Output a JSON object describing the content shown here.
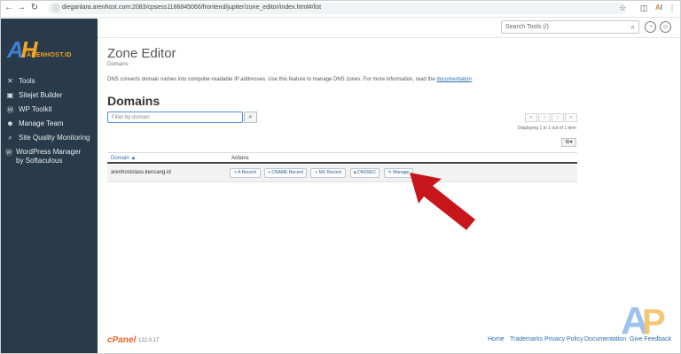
{
  "browser": {
    "url": "dieganlara.arenhost.com:2083/cpsess1186845066/frontend/jupiter/zone_editor/index.html#/list",
    "back_icon": "arrow-left",
    "forward_icon": "arrow-right",
    "reload_icon": "reload",
    "info_icon": "info"
  },
  "sidebar": {
    "logo_mark": "AH",
    "logo_text": "ARENHOST.ID",
    "items": [
      {
        "label": "Tools",
        "icon": "wrench-icon",
        "glyph": "✕"
      },
      {
        "label": "Sitejet Builder",
        "icon": "sitejet-icon",
        "glyph": "▣"
      },
      {
        "label": "WP Toolkit",
        "icon": "wordpress-icon",
        "glyph": "Ⓦ"
      },
      {
        "label": "Manage Team",
        "icon": "team-icon",
        "glyph": "☻"
      },
      {
        "label": "Site Quality Monitoring",
        "icon": "monitor-icon",
        "glyph": "⌕"
      },
      {
        "label": "WordPress Manager by Softaculous",
        "icon": "wordpress-manager-icon",
        "glyph": "Ⓦ"
      }
    ]
  },
  "header": {
    "search_placeholder": "Search Tools (/)"
  },
  "main": {
    "title": "Zone Editor",
    "breadcrumb": "Domains",
    "description": "DNS converts domain names into computer-readable IP addresses. Use this feature to manage DNS zones. For more information, read the",
    "doc_link": "documentation",
    "section_title": "Domains",
    "filter_placeholder": "Filter by domain",
    "pager": [
      "«",
      "‹",
      "›",
      "»"
    ],
    "displaying": "Displaying 1 to 1 out of 1 item",
    "table": {
      "col_domain": "Domain",
      "col_actions": "Actions",
      "rows": [
        {
          "domain": "arenhostclass.kencang.id",
          "actions": [
            "+ A Record",
            "+ CNAME Record",
            "+ MX Record",
            "DNSSEC",
            "Manage"
          ]
        }
      ]
    }
  },
  "footer": {
    "brand": "cPanel",
    "version": "122.0.17",
    "links": [
      "Home",
      "Trademarks",
      "Privacy Policy",
      "Documentation",
      "Give Feedback"
    ]
  },
  "colors": {
    "sidebar_bg": "#293a4a",
    "link": "#2a6fb0",
    "arrow": "#c8161d",
    "brand_orange": "#e8672a"
  }
}
